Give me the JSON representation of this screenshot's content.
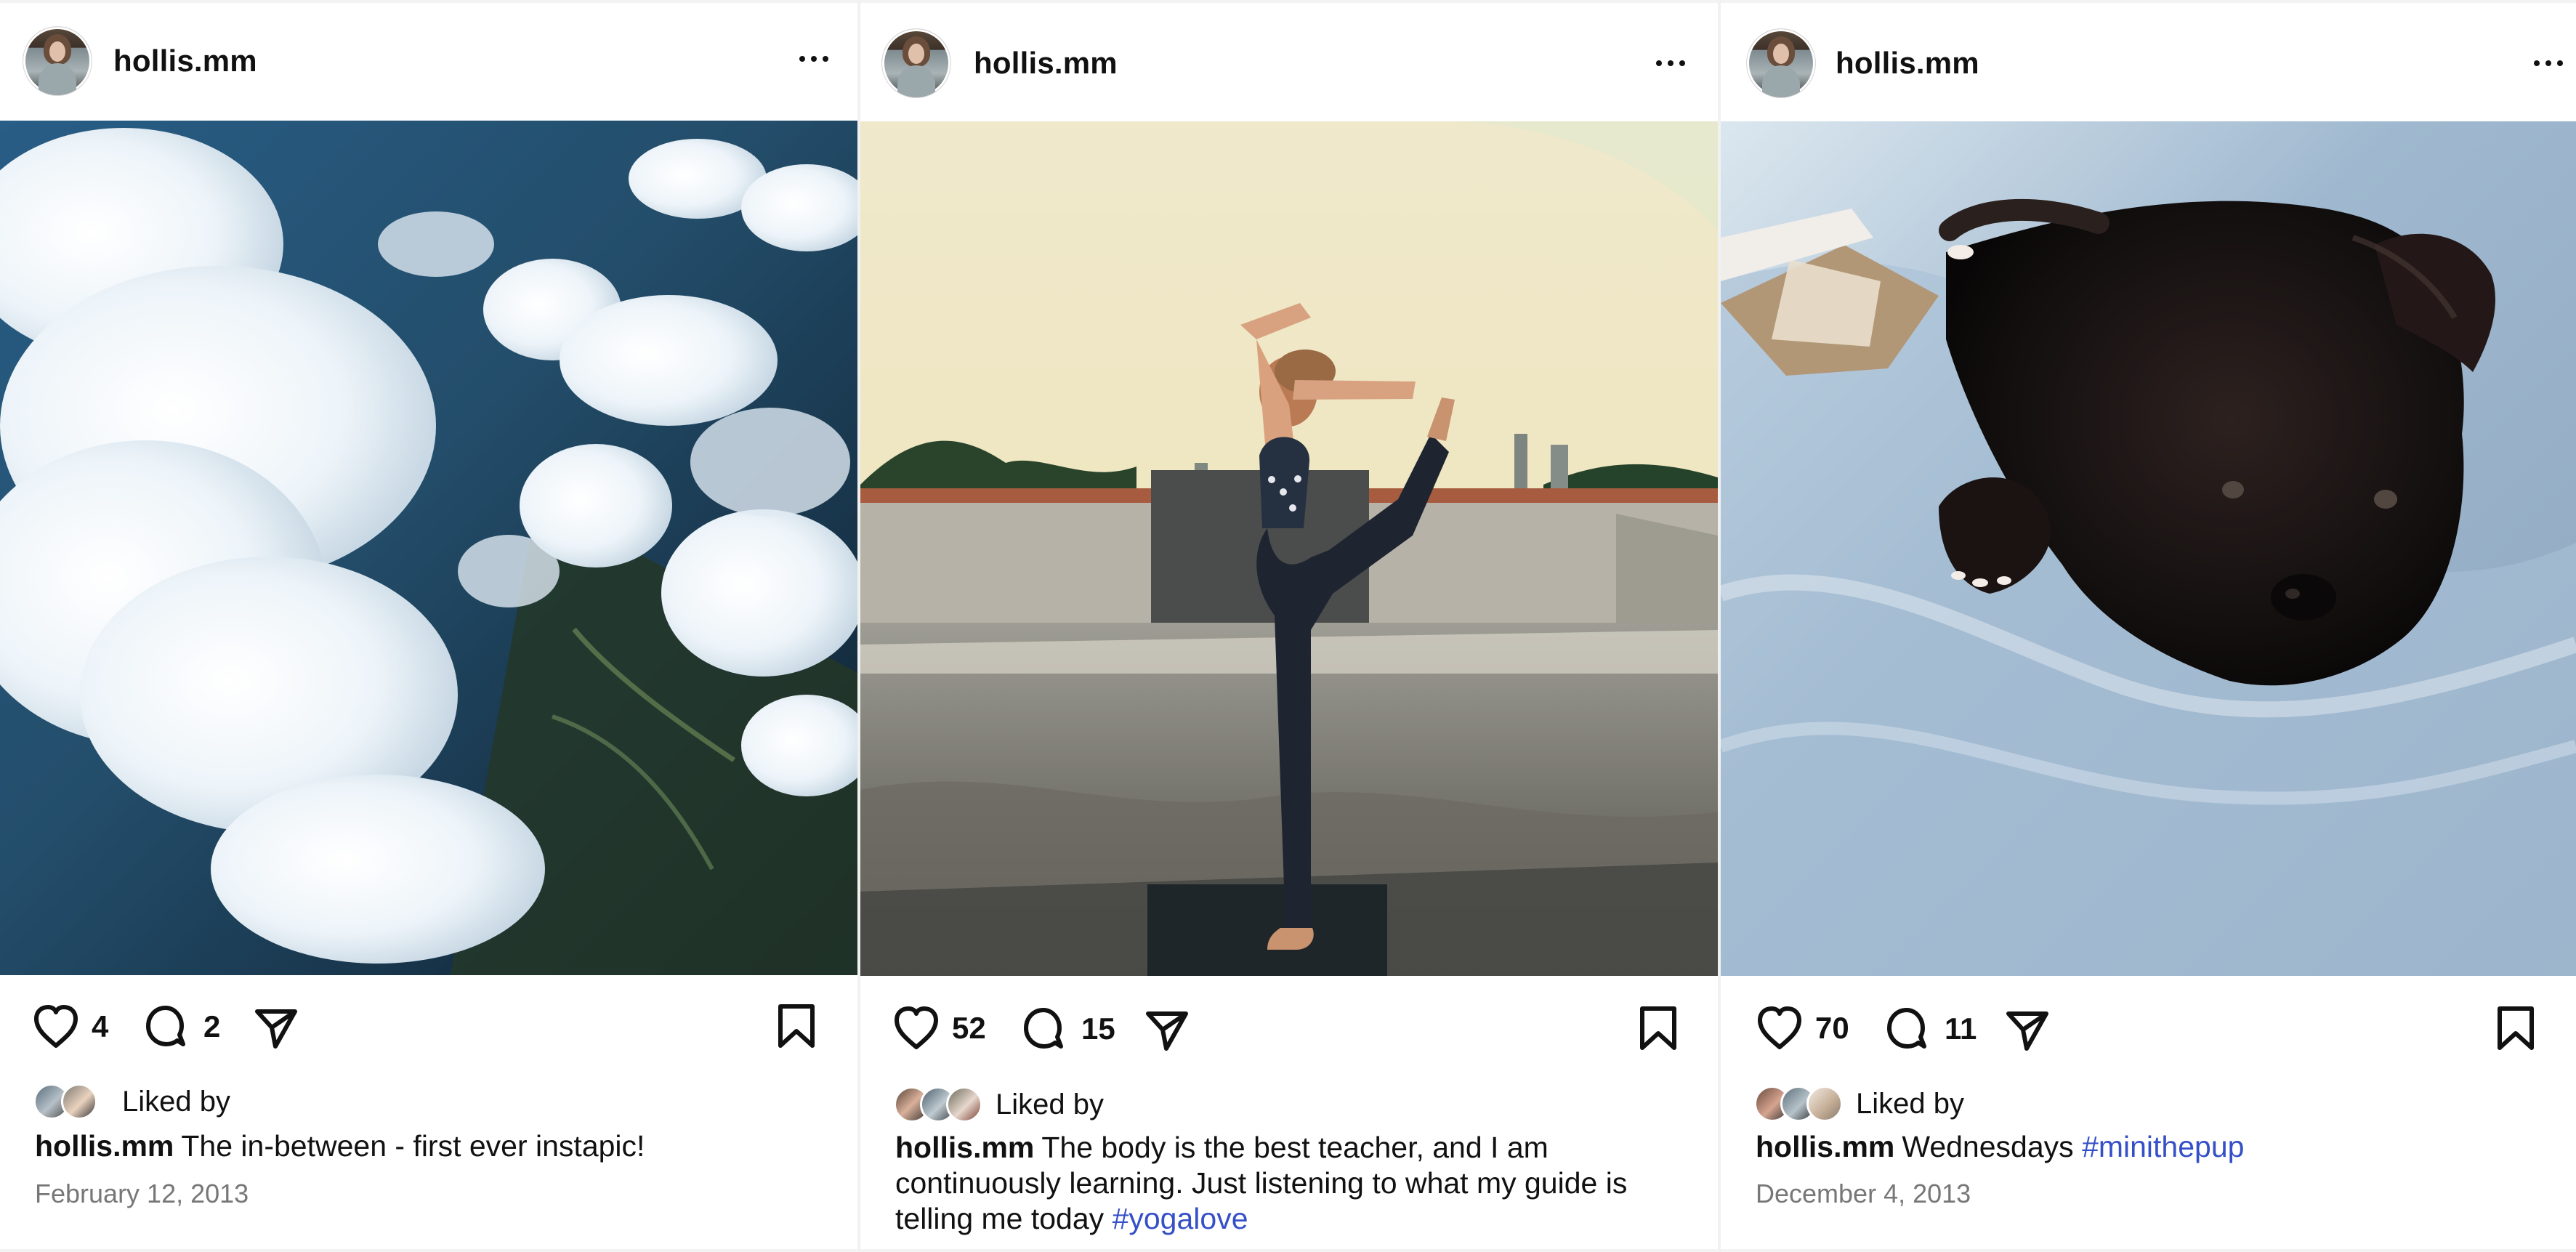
{
  "feed": {
    "posts": [
      {
        "username": "hollis.mm",
        "likes": "4",
        "comments": "2",
        "liked_by_label": "Liked by",
        "caption_user": "hollis.mm",
        "caption_text": "The in-between - first ever instapic!",
        "hashtag": "",
        "date": "February 12, 2013",
        "photo": "clouds-over-land"
      },
      {
        "username": "hollis.mm",
        "likes": "52",
        "comments": "15",
        "liked_by_label": "Liked by",
        "caption_user": "hollis.mm",
        "caption_text": "The body is the best teacher, and I am continuously learning. Just listening to what my guide is telling me today",
        "hashtag": "#yogalove",
        "date": "",
        "photo": "yoga-on-rooftop"
      },
      {
        "username": "hollis.mm",
        "likes": "70",
        "comments": "11",
        "liked_by_label": "Liked by",
        "caption_user": "hollis.mm",
        "caption_text": "Wednesdays",
        "hashtag": "#minithepup",
        "date": "December 4, 2013",
        "photo": "black-puppy-on-blanket"
      }
    ]
  },
  "icons": {
    "more": "more-options-icon",
    "like": "heart-icon",
    "comment": "comment-icon",
    "share": "share-icon",
    "save": "bookmark-icon"
  },
  "colors": {
    "text": "#111111",
    "muted": "#777777",
    "link": "#3550c7",
    "background": "#ffffff"
  }
}
